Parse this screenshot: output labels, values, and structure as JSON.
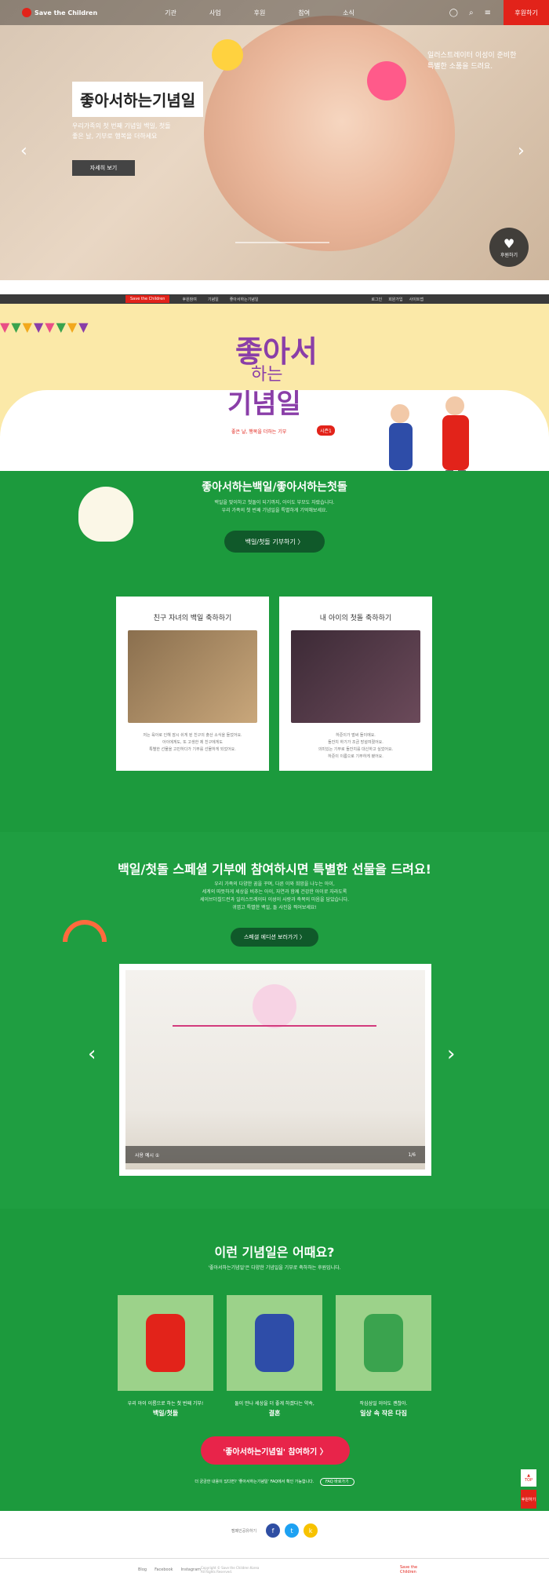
{
  "colors": {
    "brand_red": "#e2231a",
    "green": "#1c9a3d",
    "dark_green": "#10592a",
    "pink_cta": "#e8244a"
  },
  "header": {
    "logo_text": "Save the Children",
    "menu": [
      "기관",
      "사업",
      "후원",
      "참여",
      "소식"
    ],
    "icons": [
      "user-icon",
      "search-icon",
      "menu-icon"
    ],
    "donate_label": "후원하기"
  },
  "hero": {
    "title": "좋아서하는기념일",
    "desc_lines": [
      "우리가족의 첫 번째 기념일 백일, 첫돌",
      "좋은 날, 기부로 행복을 더하세요"
    ],
    "more_label": "자세히 보기",
    "handwrite": "일러스트레이터 이성이 준비한 특별한 소품을 드려요.",
    "like_label": "후원하기"
  },
  "subbar": {
    "brand": "Save the Children",
    "crumbs": [
      "후원참여",
      "기념일",
      "좋아서하는기념일"
    ],
    "right": [
      "로그인",
      "회원가입",
      "사이트맵"
    ]
  },
  "intro": {
    "line1": "좋아서",
    "line2": "하는",
    "line3": "기념일",
    "sub": "좋은 날, 행복을 더하는 기부",
    "badge": "시즌1"
  },
  "section1": {
    "title": "좋아서하는백일/좋아서하는첫돌",
    "desc_lines": [
      "백일을 맞이하고 첫돌이 되기까지, 아이도 부모도 자랐습니다.",
      "우리 가족의 첫 번째 기념일을 특별하게 기억해보세요."
    ],
    "cta": "백일/첫돌 기부하기 〉",
    "cards": [
      {
        "title": "친구 자녀의 백일 축하하기",
        "desc": [
          "저는 육아로 인해 잠시 쉬게 된 친구의 출산 소식을 들었어요.",
          "아이에게도, 또 고생한 제 친구에게도",
          "특별한 선물을 고민하다가 기부를 선물하게 되었어요."
        ]
      },
      {
        "title": "내 아이의 첫돌 축하하기",
        "desc": [
          "하준이가 벌써 돌이에요.",
          "돌잔치 하기가 조금 망설여졌어요.",
          "의미있는 기부로 돌잔치를 대신하고 싶었어요.",
          "하준이 이름으로 기부하게 됐어요."
        ]
      }
    ]
  },
  "section2": {
    "title": "백일/첫돌 스페셜 기부에 참여하시면 특별한 선물을 드려요!",
    "desc_lines": [
      "우리 가족의 다양한 꿈을 꾸며, 다른 이와 희망을 나누는 아이,",
      "세계의 따뜻하게 세상을 비추는 아이, 자연과 함께 건강한 아이로 자라도록",
      "세이브더칠드런과 일러스트레이터 이성이 사랑과 축복의 마음을 담았습니다.",
      "귀엽고 특별한 백일, 돌 사진을 찍어보세요!"
    ],
    "cta": "스페셜 에디션 보러가기 〉",
    "slide_caption": "사용 예시 ①",
    "slide_counter": "1/6"
  },
  "section3": {
    "title": "이런 기념일은 어때요?",
    "desc": "'좋아서하는기념일'은 다양한 기념일을 기부로 축하하는 후원입니다.",
    "items": [
      {
        "desc": "우리 아이 이름으로 하는 첫 번째 기부!",
        "label": "백일/첫돌"
      },
      {
        "desc": "둘이 만나 세상을 더 좋게 하겠다는 약속,",
        "label": "결혼"
      },
      {
        "desc": "작심삼일 이어도 괜찮아.",
        "label": "일상 속 작은 다짐"
      }
    ],
    "cta": "'좋아서하는기념일' 참여하기 〉",
    "faq_text": "더 궁금한 내용이 있다면? '좋아서하는기념일' FAQ에서 확인 가능합니다.",
    "faq_btn": "FAQ 바로가기",
    "top_label": "TOP",
    "donate_label": "후원하기"
  },
  "share": {
    "label": "캠페인공유하기",
    "networks": [
      "f",
      "t",
      "k"
    ]
  },
  "footer": {
    "links": [
      "Blog",
      "Facebook",
      "Instagram"
    ],
    "copy": "Copyright © Save the Children Korea All Rights Reserved.",
    "brand": "Save the Children"
  }
}
